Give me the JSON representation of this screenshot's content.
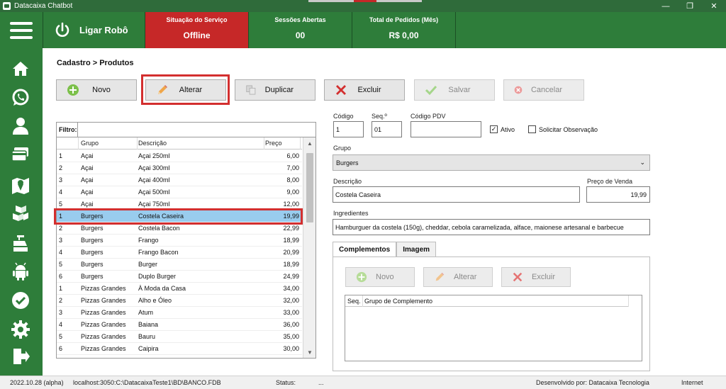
{
  "window": {
    "title": "Datacaixa Chatbot",
    "minimize": "—",
    "maximize": "❐",
    "close": "✕"
  },
  "header": {
    "robot_label": "Ligar Robô",
    "stats": [
      {
        "caption": "Situação do Serviço",
        "value": "Offline"
      },
      {
        "caption": "Sessões Abertas",
        "value": "00"
      },
      {
        "caption": "Total de Pedidos (Mês)",
        "value": "R$ 0,00"
      }
    ]
  },
  "breadcrumb": "Cadastro > Produtos",
  "toolbar": {
    "novo": "Novo",
    "alterar": "Alterar",
    "duplicar": "Duplicar",
    "excluir": "Excluir",
    "salvar": "Salvar",
    "cancelar": "Cancelar"
  },
  "filter": {
    "label": "Filtro:",
    "value": ""
  },
  "grid": {
    "headers": [
      "Grupo",
      "Descrição",
      "Preço"
    ],
    "rows": [
      [
        "1",
        "Açai",
        "Açai 250ml",
        "6,00"
      ],
      [
        "2",
        "Açai",
        "Açai 300ml",
        "7,00"
      ],
      [
        "3",
        "Açai",
        "Açai 400ml",
        "8,00"
      ],
      [
        "4",
        "Açai",
        "Açai 500ml",
        "9,00"
      ],
      [
        "5",
        "Açai",
        "Açai 750ml",
        "12,00"
      ],
      [
        "1",
        "Burgers",
        "Costela Caseira",
        "19,99"
      ],
      [
        "2",
        "Burgers",
        "Costela Bacon",
        "22,99"
      ],
      [
        "3",
        "Burgers",
        "Frango",
        "18,99"
      ],
      [
        "4",
        "Burgers",
        "Frango Bacon",
        "20,99"
      ],
      [
        "5",
        "Burgers",
        "Burger",
        "18,99"
      ],
      [
        "6",
        "Burgers",
        "Duplo Burger",
        "24,99"
      ],
      [
        "1",
        "Pizzas Grandes",
        "À Moda da Casa",
        "34,00"
      ],
      [
        "2",
        "Pizzas Grandes",
        "Alho e Óleo",
        "32,00"
      ],
      [
        "3",
        "Pizzas Grandes",
        "Atum",
        "33,00"
      ],
      [
        "4",
        "Pizzas Grandes",
        "Baiana",
        "36,00"
      ],
      [
        "5",
        "Pizzas Grandes",
        "Bauru",
        "35,00"
      ],
      [
        "6",
        "Pizzas Grandes",
        "Caipira",
        "30,00"
      ]
    ],
    "selected_index": 5
  },
  "form": {
    "codigo_label": "Código",
    "codigo": "1",
    "seq_label": "Seq.º",
    "seq": "01",
    "pdv_label": "Código PDV",
    "pdv": "",
    "ativo_label": "Ativo",
    "ativo_checked": "✓",
    "obs_label": "Solicitar Observação",
    "grupo_label": "Grupo",
    "grupo": "Burgers",
    "descricao_label": "Descrição",
    "descricao": "Costela Caseira",
    "preco_label": "Preço de Venda",
    "preco": "19,99",
    "ingredientes_label": "Ingredientes",
    "ingredientes": "Hamburguer da costela (150g), cheddar, cebola caramelizada, alface, maionese artesanal e barbecue"
  },
  "tabs": {
    "complementos": "Complementos",
    "imagem": "Imagem"
  },
  "subtoolbar": {
    "novo": "Novo",
    "alterar": "Alterar",
    "excluir": "Excluir"
  },
  "subgrid": {
    "seq": "Seq.",
    "grupo": "Grupo de Complemento"
  },
  "statusbar": {
    "version": "2022.10.28 (alpha)",
    "db": "localhost:3050:C:\\DatacaixaTeste1\\BD\\BANCO.FDB",
    "status_label": "Status:",
    "status_value": "...",
    "dev": "Desenvolvido por: Datacaixa Tecnologia",
    "net": "Internet"
  },
  "colors": {
    "green": "#2e7d3a",
    "red": "#c62828",
    "selection": "#99ccee"
  }
}
